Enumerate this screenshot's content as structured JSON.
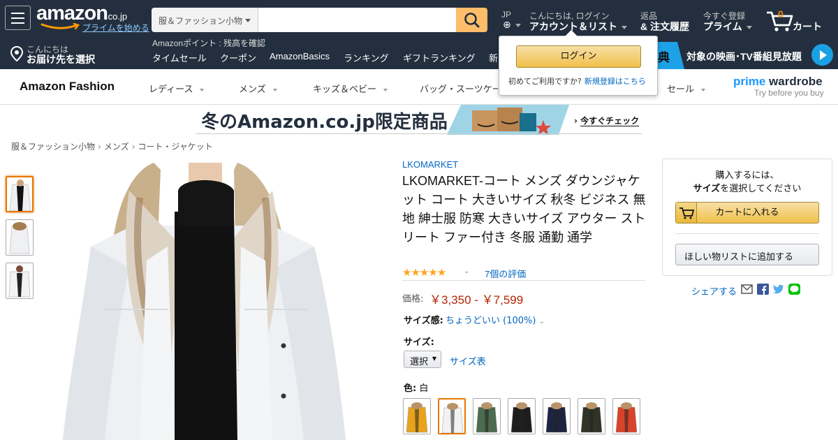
{
  "header": {
    "logo_text": "amazon",
    "logo_tld": ".co.jp",
    "prime_link": "プライムを始める",
    "search": {
      "category": "服＆ファッション小物",
      "placeholder": "",
      "value": ""
    },
    "language": {
      "code": "JP"
    },
    "account": {
      "greeting": "こんにちは, ログイン",
      "label": "アカウント＆リスト"
    },
    "orders": {
      "line1": "返品",
      "line2": "& 注文履歴"
    },
    "prime": {
      "line1": "今すぐ登録",
      "line2": "プライム"
    },
    "cart": {
      "count": "0",
      "label": "カート"
    }
  },
  "subnav": {
    "deliver": {
      "line1": "こんにちは",
      "line2": "お届け先を選択"
    },
    "points": "Amazonポイント : 残高を確認",
    "links": [
      "タイムセール",
      "クーポン",
      "AmazonBasics",
      "ランキング",
      "ギフトランキング",
      "新"
    ],
    "promo": {
      "badge": "典",
      "text": "対象の映画･TV番組見放題"
    }
  },
  "signin_flyout": {
    "button": "ログイン",
    "first_time": "初めてご利用ですか?",
    "register_link": "新規登録はこちら"
  },
  "fashion_nav": {
    "title": "Amazon Fashion",
    "items": [
      "レディース",
      "メンズ",
      "キッズ＆ベビー",
      "バッグ・スーツケース",
      "セール"
    ],
    "brand": {
      "word1": "prime",
      "word2": "wardrobe",
      "tagline": "Try before you buy"
    }
  },
  "banner": {
    "text": "冬のAmazon.co.jp限定商品",
    "cta": "今すぐチェック"
  },
  "breadcrumb": [
    "服＆ファッション小物",
    "メンズ",
    "コート・ジャケット"
  ],
  "product": {
    "brand": "LKOMARKET",
    "title": "LKOMARKET-コート メンズ ダウンジャケット コート 大きいサイズ 秋冬 ビジネス 無地 紳士服 防寒 大きいサイズ アウター ストリート ファー付き 冬服 通勤 通学",
    "rating_stars": 5,
    "rating_count": "7個の評価",
    "price_label": "価格:",
    "price": "￥3,350 - ￥7,599",
    "fit_label": "サイズ感:",
    "fit_value": "ちょうどいい (100%)",
    "size_label": "サイズ:",
    "size_selected": "選択",
    "size_chart": "サイズ表",
    "color_label": "色:",
    "color_value": "白",
    "swatches": [
      {
        "name": "yellow",
        "color": "#e8a21c"
      },
      {
        "name": "white",
        "color": "#f2f2f2"
      },
      {
        "name": "green",
        "color": "#4d6b4f"
      },
      {
        "name": "white-black",
        "color": "#1d1d1f"
      },
      {
        "name": "navy",
        "color": "#1d2440"
      },
      {
        "name": "army-green",
        "color": "#2f3427"
      },
      {
        "name": "red",
        "color": "#d8432c"
      }
    ]
  },
  "buybox": {
    "line1": "購入するには、",
    "line2_bold": "サイズ",
    "line2_rest": "を選択してください",
    "add_to_cart": "カートに入れる",
    "wishlist": "ほしい物リストに追加する",
    "share": "シェアする"
  },
  "colors": {
    "nav_dark": "#232f3e",
    "search_button": "#febd69",
    "link": "#0066c0",
    "price": "#b12704",
    "star": "#ffa41c",
    "button_yellow": "#f0c14b"
  }
}
